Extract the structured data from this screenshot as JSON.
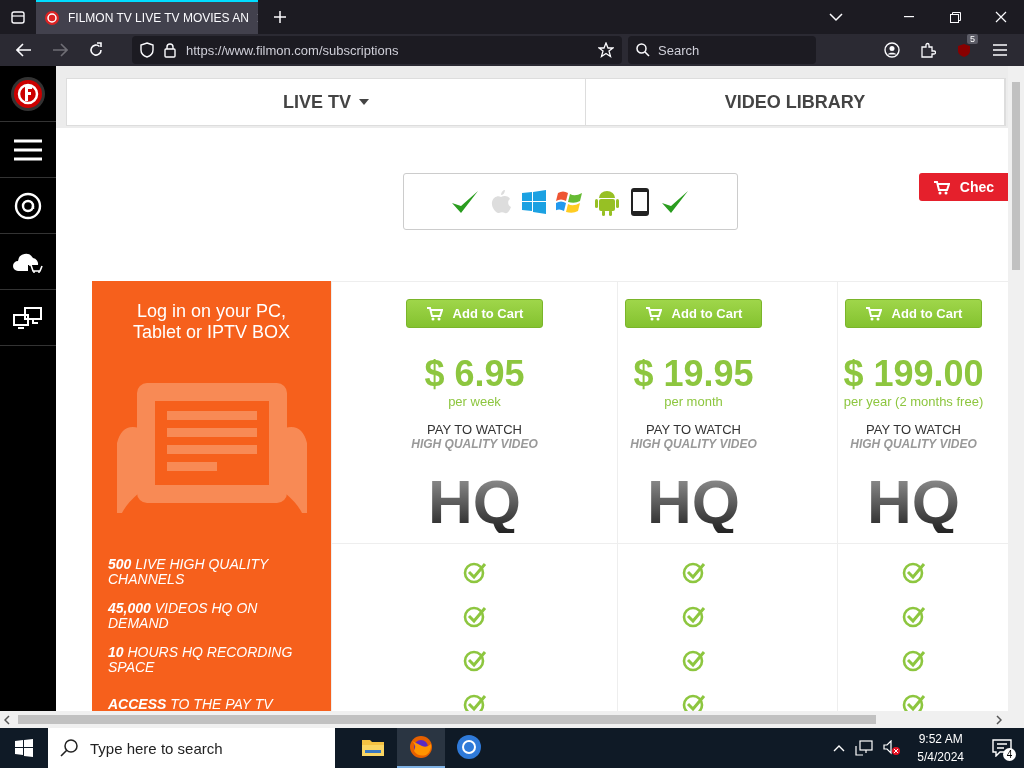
{
  "browser": {
    "tab": {
      "title": "FILMON TV LIVE TV MOVIES AN",
      "selected": true
    },
    "url": "https://www.filmon.com/subscriptions",
    "search_placeholder": "Search",
    "extension_badge": "5"
  },
  "nav_tabs": [
    {
      "label": "LIVE TV",
      "dropdown": true
    },
    {
      "label": "VIDEO LIBRARY",
      "dropdown": false
    }
  ],
  "checkout_button": "Chec",
  "promo": {
    "title_lines": [
      "Log in on your PC,",
      "Tablet or IPTV BOX"
    ],
    "features": [
      "**500** LIVE HIGH QUALITY CHANNELS",
      "**45,000** VIDEOS HQ ON DEMAND",
      "**10** HOURS HQ RECORDING SPACE",
      "**ACCESS** TO THE PAY TV"
    ]
  },
  "plans": [
    {
      "button": "Add to Cart",
      "price": "$ 6.95",
      "period": "per week",
      "access": "PAY TO WATCH",
      "quality": "HIGH QUALITY VIDEO",
      "badge": "HQ",
      "features": [
        {
          "included": true
        },
        {
          "included": true
        },
        {
          "included": true
        },
        {
          "included": true
        }
      ]
    },
    {
      "button": "Add to Cart",
      "price": "$ 19.95",
      "period": "per month",
      "access": "PAY TO WATCH",
      "quality": "HIGH QUALITY VIDEO",
      "badge": "HQ",
      "features": [
        {
          "included": true
        },
        {
          "included": true
        },
        {
          "included": true
        },
        {
          "included": true
        }
      ]
    },
    {
      "button": "Add to Cart",
      "price": "$ 199.00",
      "period": "per year (2 months free)",
      "access": "PAY TO WATCH",
      "quality": "HIGH QUALITY VIDEO",
      "badge": "HQ",
      "features": [
        {
          "included": true
        },
        {
          "included": true
        },
        {
          "included": true
        },
        {
          "included": true
        }
      ]
    }
  ],
  "taskbar": {
    "search_placeholder": "Type here to search",
    "apps": [
      {
        "kind": "files",
        "selected": false
      },
      {
        "kind": "firefox",
        "selected": true
      },
      {
        "kind": "chrome",
        "selected": false
      }
    ],
    "time": "9:52 AM",
    "date": "5/4/2024",
    "notifications": "4"
  }
}
